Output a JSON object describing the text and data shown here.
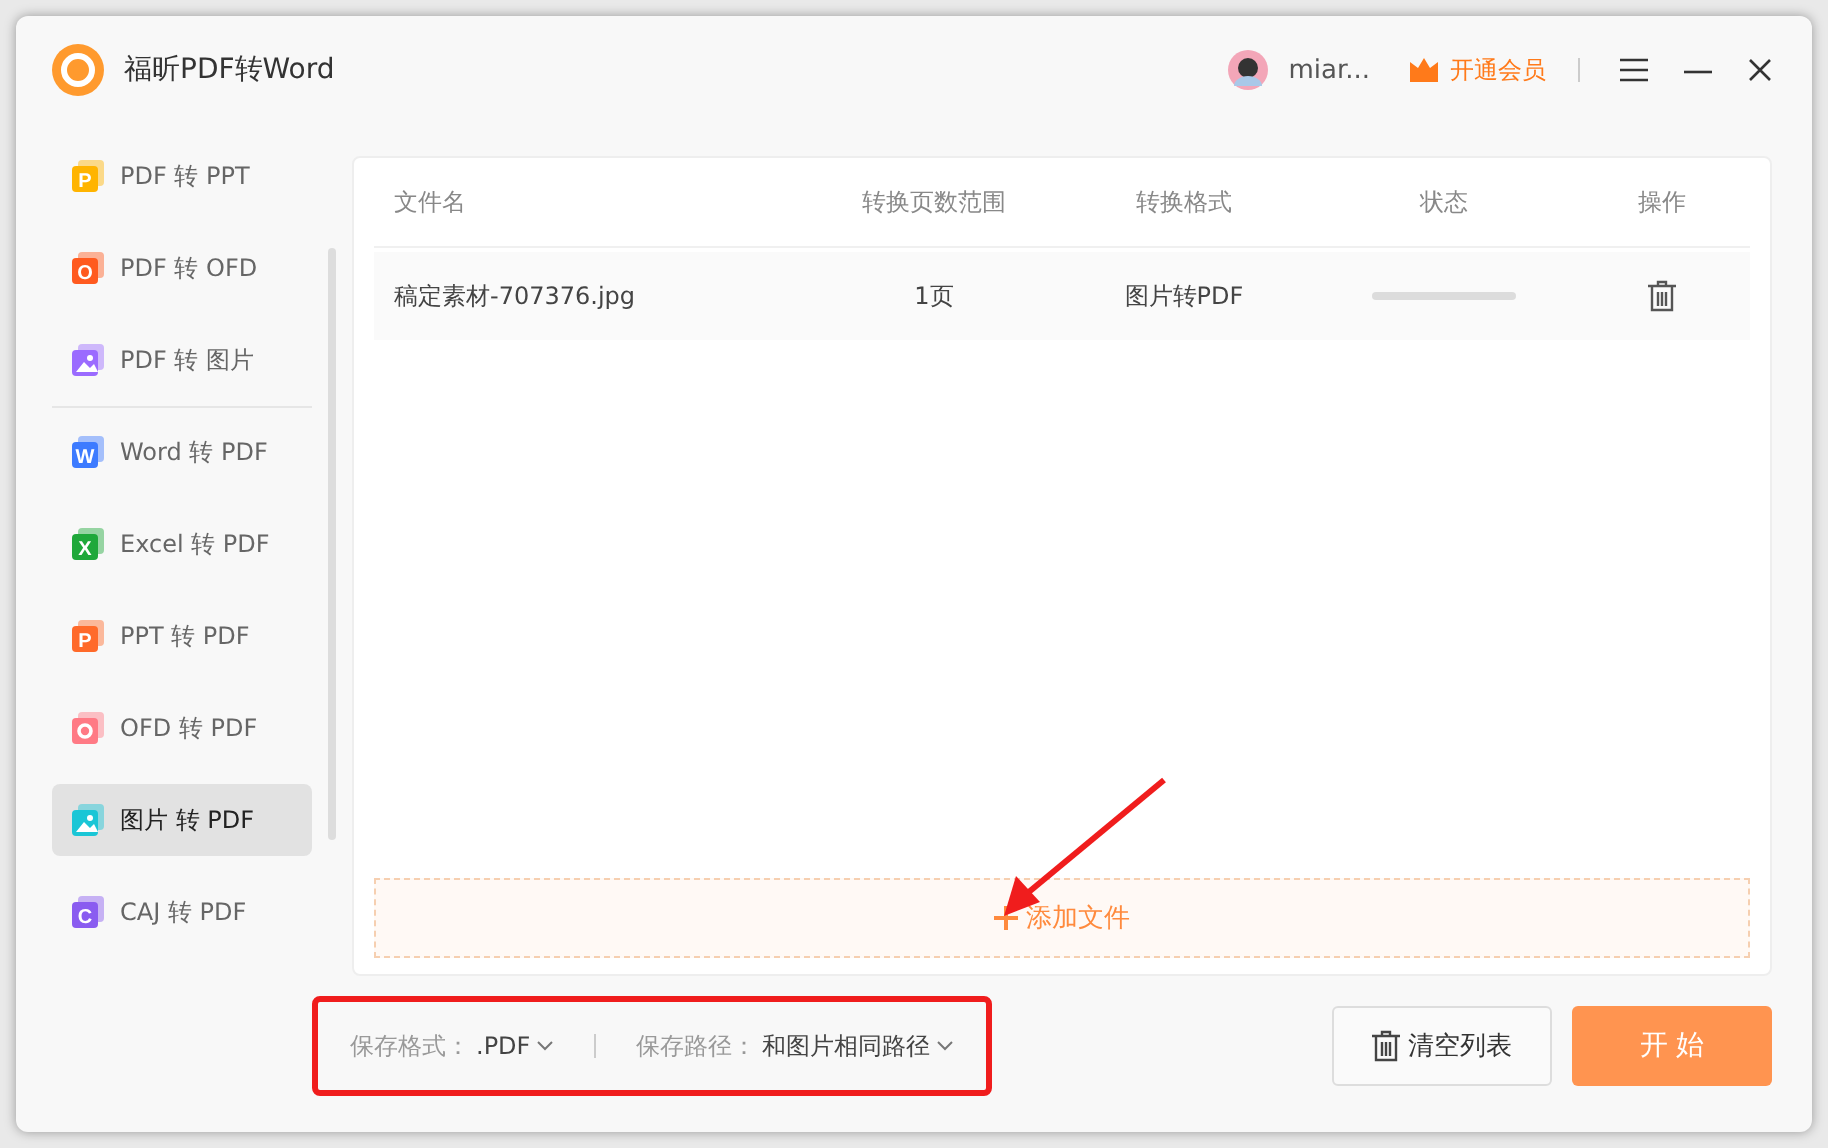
{
  "window": {
    "title": "福昕PDF转Word",
    "user": "miar...",
    "vip": "开通会员"
  },
  "sidebar": {
    "items": [
      {
        "label": "PDF 转 PPT",
        "selected": false,
        "icon": {
          "kind": "letter",
          "letter": "P",
          "color": "#ffb400"
        }
      },
      {
        "label": "PDF 转 OFD",
        "selected": false,
        "icon": {
          "kind": "letter",
          "letter": "O",
          "color": "#ff5a1f"
        }
      },
      {
        "label": "PDF 转 图片",
        "selected": false,
        "icon": {
          "kind": "image",
          "color": "#9b6bff"
        },
        "divider_after": true
      },
      {
        "label": "Word 转 PDF",
        "selected": false,
        "icon": {
          "kind": "letter",
          "letter": "W",
          "color": "#3d7bff"
        }
      },
      {
        "label": "Excel 转 PDF",
        "selected": false,
        "icon": {
          "kind": "letter",
          "letter": "X",
          "color": "#1fa83a"
        }
      },
      {
        "label": "PPT 转 PDF",
        "selected": false,
        "icon": {
          "kind": "letter",
          "letter": "P",
          "color": "#ff6a2a"
        }
      },
      {
        "label": "OFD 转 PDF",
        "selected": false,
        "icon": {
          "kind": "ring",
          "color": "#ff7a85"
        }
      },
      {
        "label": "图片 转 PDF",
        "selected": true,
        "icon": {
          "kind": "image",
          "color": "#1ac6d6"
        }
      },
      {
        "label": "CAJ 转 PDF",
        "selected": false,
        "icon": {
          "kind": "letter",
          "letter": "C",
          "color": "#8a5cf0"
        }
      }
    ]
  },
  "table": {
    "columns": [
      "文件名",
      "转换页数范围",
      "转换格式",
      "状态",
      "操作"
    ],
    "rows": [
      {
        "file": "稿定素材-707376.jpg",
        "pages": "1页",
        "format": "图片转PDF"
      }
    ]
  },
  "add_files": {
    "label": "添加文件"
  },
  "footer": {
    "format_label": "保存格式：",
    "format_value": ".PDF",
    "path_label": "保存路径：",
    "path_value": "和图片相同路径",
    "clear": "清空列表",
    "start": "开 始"
  },
  "annotations": {
    "arrow": true,
    "highlight": true
  }
}
